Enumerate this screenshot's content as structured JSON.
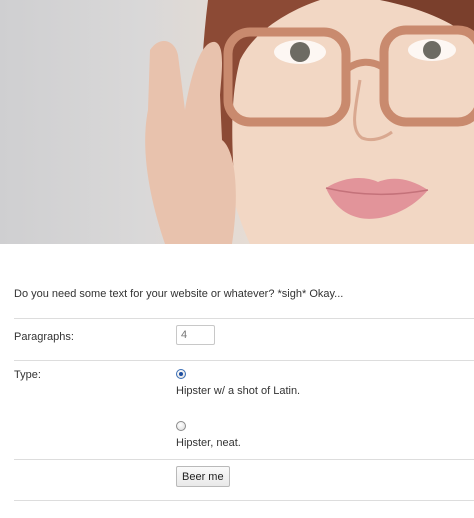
{
  "intro_text": "Do you need some text for your website or whatever? *sigh* Okay...",
  "form": {
    "paragraphs_label": "Paragraphs:",
    "paragraphs_placeholder": "4",
    "type_label": "Type:",
    "type_options": [
      {
        "label": "Hipster w/ a shot of Latin.",
        "checked": true
      },
      {
        "label": "Hipster, neat.",
        "checked": false
      }
    ],
    "submit_label": "Beer me"
  },
  "colors": {
    "rule": "#dddddd",
    "text": "#333333",
    "radio_selected": "#1e4fa0"
  }
}
